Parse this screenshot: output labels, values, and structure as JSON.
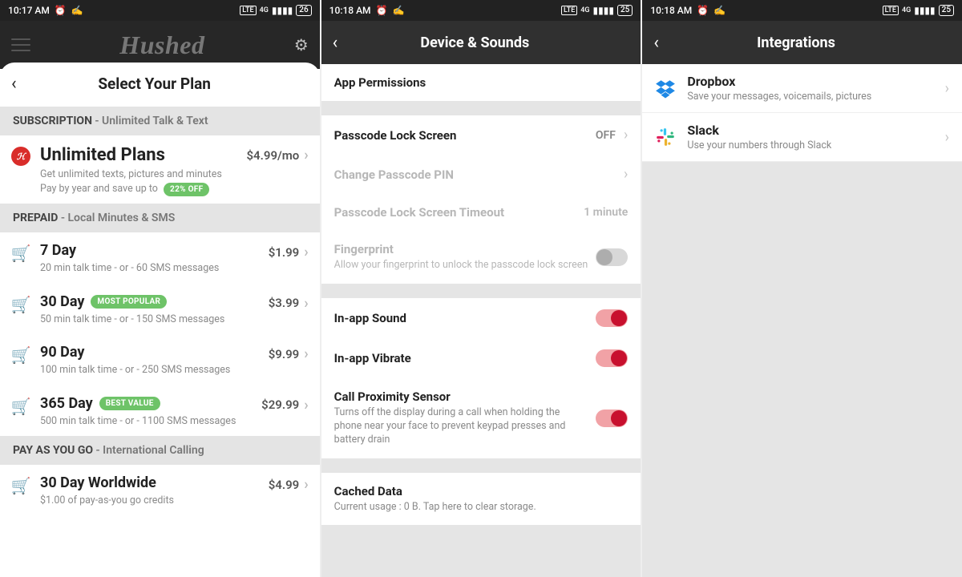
{
  "screen1": {
    "status": {
      "time": "10:17 AM",
      "battery": "26"
    },
    "brand": "Hushed",
    "page_title": "Select Your Plan",
    "sections": {
      "subscription": {
        "label": "SUBSCRIPTION",
        "sub": " - Unlimited Talk & Text"
      },
      "prepaid": {
        "label": "PREPAID",
        "sub": " - Local Minutes & SMS"
      },
      "payg": {
        "label": "PAY AS YOU GO",
        "sub": " - International Calling"
      }
    },
    "unlimited": {
      "name": "Unlimited Plans",
      "price": "$4.99/mo",
      "line1": "Get unlimited texts, pictures and minutes",
      "line2": "Pay by year and save up to",
      "tag": "22% OFF"
    },
    "prepaid_plans": [
      {
        "name": "7 Day",
        "price": "$1.99",
        "sub": "20 min talk time - or - 60 SMS messages",
        "tag": ""
      },
      {
        "name": "30 Day",
        "price": "$3.99",
        "sub": "50 min talk time - or - 150 SMS messages",
        "tag": "MOST POPULAR"
      },
      {
        "name": "90 Day",
        "price": "$9.99",
        "sub": "100 min talk time - or - 250 SMS messages",
        "tag": ""
      },
      {
        "name": "365 Day",
        "price": "$29.99",
        "sub": "500 min talk time - or - 1100 SMS messages",
        "tag": "BEST VALUE"
      }
    ],
    "payg_plan": {
      "name": "30 Day Worldwide",
      "price": "$4.99",
      "sub": "$1.00 of pay-as-you go credits"
    }
  },
  "screen2": {
    "status": {
      "time": "10:18 AM",
      "battery": "25"
    },
    "title": "Device & Sounds",
    "rows": {
      "app_permissions": "App Permissions",
      "passcode_lock": {
        "label": "Passcode Lock Screen",
        "value": "OFF"
      },
      "change_pin": "Change Passcode PIN",
      "lock_timeout": {
        "label": "Passcode Lock Screen Timeout",
        "value": "1 minute"
      },
      "fingerprint": {
        "label": "Fingerprint",
        "sub": "Allow your fingerprint to unlock the passcode lock screen"
      },
      "sound": "In-app Sound",
      "vibrate": "In-app Vibrate",
      "proximity": {
        "label": "Call Proximity Sensor",
        "sub": "Turns off the display during a call when holding the phone near your face to prevent keypad presses and battery drain"
      },
      "cached": {
        "label": "Cached Data",
        "sub": "Current usage : 0 B. Tap here to clear storage."
      }
    }
  },
  "screen3": {
    "status": {
      "time": "10:18 AM",
      "battery": "25"
    },
    "title": "Integrations",
    "items": [
      {
        "name": "Dropbox",
        "sub": "Save your messages, voicemails, pictures"
      },
      {
        "name": "Slack",
        "sub": "Use your numbers through Slack"
      }
    ]
  }
}
